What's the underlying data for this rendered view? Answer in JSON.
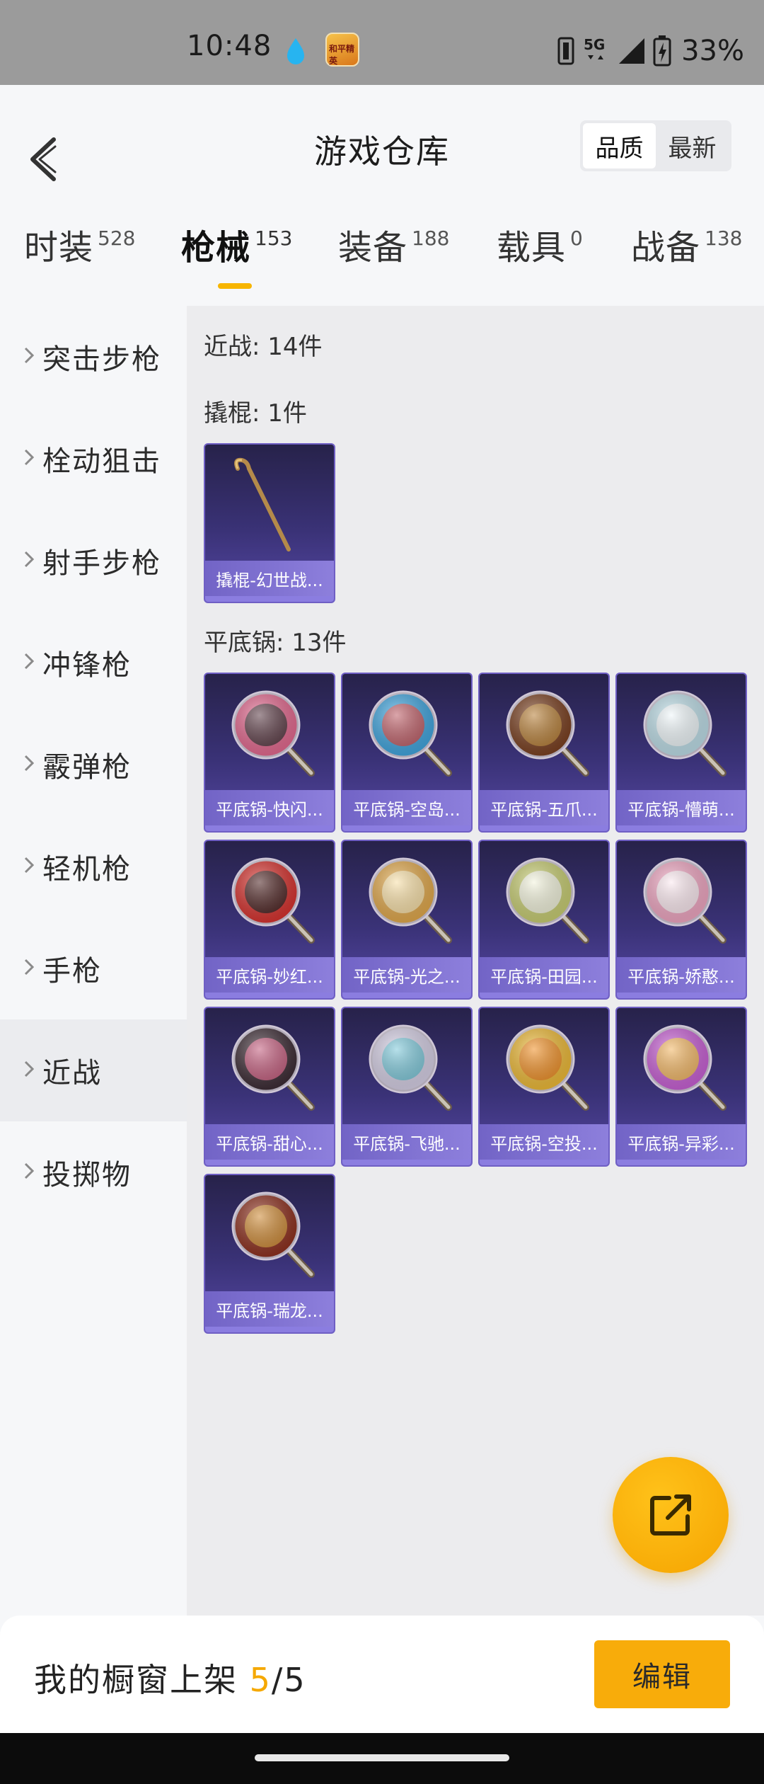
{
  "status_bar": {
    "time": "10:48",
    "app_icon_text": "和平精英",
    "network": "5G",
    "battery": "33%"
  },
  "header": {
    "title": "游戏仓库",
    "sort_options": [
      "品质",
      "最新"
    ],
    "active_sort": "品质"
  },
  "tabs": [
    {
      "label": "时装",
      "count": "528"
    },
    {
      "label": "枪械",
      "count": "153"
    },
    {
      "label": "装备",
      "count": "188"
    },
    {
      "label": "载具",
      "count": "0"
    },
    {
      "label": "战备",
      "count": "138"
    }
  ],
  "active_tab": "枪械",
  "sidebar": {
    "items": [
      "突击步枪",
      "栓动狙击",
      "射手步枪",
      "冲锋枪",
      "霰弹枪",
      "轻机枪",
      "手枪",
      "近战",
      "投掷物"
    ],
    "active": "近战"
  },
  "content": {
    "summary": "近战: 14件",
    "groups": [
      {
        "title": "撬棍: 1件",
        "items": [
          {
            "label": "撬棍-幻世战...",
            "art": "crowbar"
          }
        ]
      },
      {
        "title": "平底锅: 13件",
        "items": [
          {
            "label": "平底锅-快闪...",
            "art": "pan",
            "color": "#e5688f",
            "accent": "#2b2b2b"
          },
          {
            "label": "平底锅-空岛...",
            "art": "pan",
            "color": "#3fa6e0",
            "accent": "#e8433c"
          },
          {
            "label": "平底锅-五爪...",
            "art": "pan",
            "color": "#7a3f1f",
            "accent": "#c9913b"
          },
          {
            "label": "平底锅-懵萌...",
            "art": "pan",
            "color": "#bfe0ea",
            "accent": "#ffffff"
          },
          {
            "label": "平底锅-妙红...",
            "art": "pan",
            "color": "#d8312d",
            "accent": "#1b1b1b"
          },
          {
            "label": "平底锅-光之...",
            "art": "pan",
            "color": "#e3a94a",
            "accent": "#fff1c4"
          },
          {
            "label": "平底锅-田园...",
            "art": "pan",
            "color": "#c9cf72",
            "accent": "#ffffff"
          },
          {
            "label": "平底锅-娇憨...",
            "art": "pan",
            "color": "#f2a7c3",
            "accent": "#ffffff"
          },
          {
            "label": "平底锅-甜心...",
            "art": "pan",
            "color": "#3b2a33",
            "accent": "#f06b94"
          },
          {
            "label": "平底锅-飞驰...",
            "art": "pan",
            "color": "#d8d2e8",
            "accent": "#5ec4d6"
          },
          {
            "label": "平底锅-空投...",
            "art": "pan",
            "color": "#f0bb35",
            "accent": "#ef7d1b"
          },
          {
            "label": "平底锅-异彩...",
            "art": "pan",
            "color": "#c95fd6",
            "accent": "#ffd23a"
          },
          {
            "label": "平底锅-瑞龙...",
            "art": "pan",
            "color": "#8e2f1d",
            "accent": "#e0a638"
          }
        ]
      }
    ]
  },
  "bottom_bar": {
    "showcase_label": "我的橱窗上架",
    "showcase_current": "5",
    "showcase_total": "/5",
    "edit_label": "编辑"
  },
  "icons": {
    "back": "back-arrow-icon",
    "share": "share-icon",
    "sidebar_chevron": "chevron-right-icon"
  },
  "colors": {
    "accent": "#f7b500",
    "card_gradient_top": "#27224a",
    "card_gradient_bottom": "#5547a3"
  }
}
